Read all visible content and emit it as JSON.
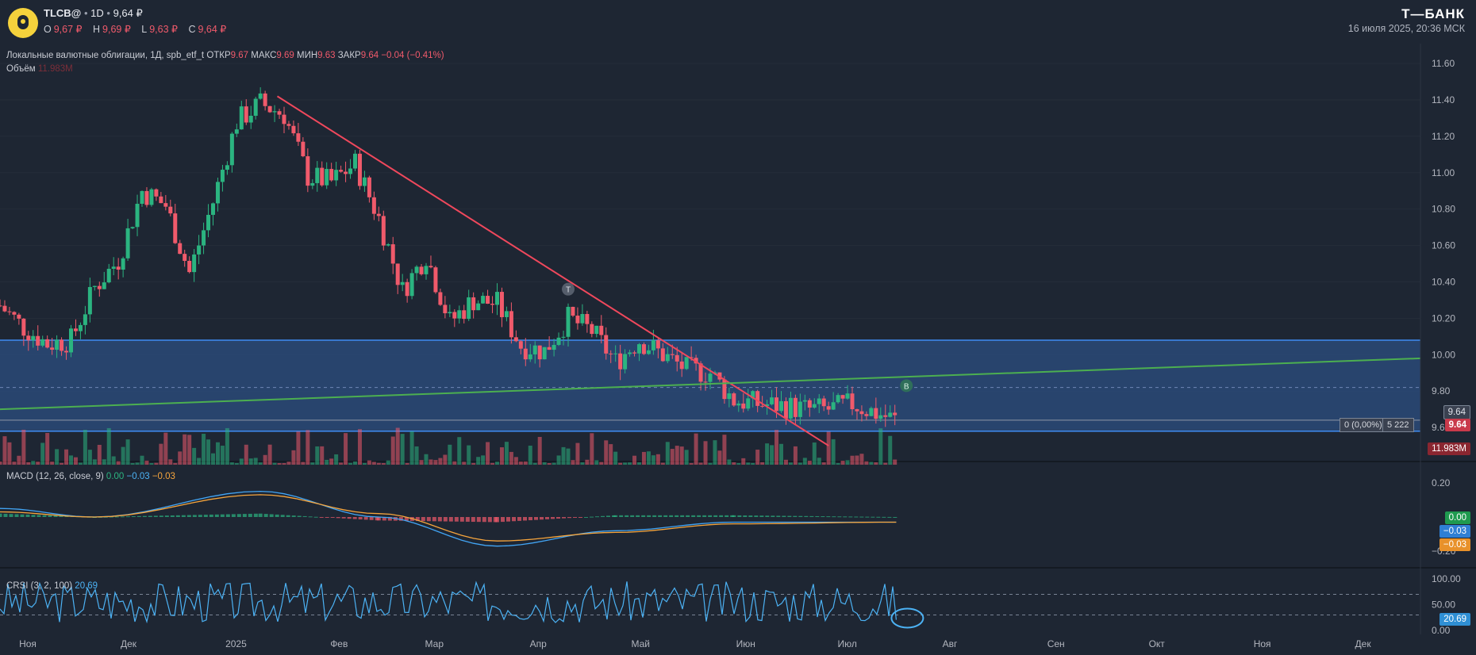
{
  "header": {
    "ticker": "TLCB@",
    "interval": "1D",
    "price": "9,64 ₽",
    "ohlc": [
      {
        "k": "O",
        "v": "9,67 ₽"
      },
      {
        "k": "H",
        "v": "9,69 ₽"
      },
      {
        "k": "L",
        "v": "9,63 ₽"
      },
      {
        "k": "C",
        "v": "9,64 ₽"
      }
    ],
    "brand": "Т—БАНК",
    "datetime": "16 июля 2025, 20:36 МСК"
  },
  "legend": {
    "name": "Локальные валютные облигации, 1Д, spb_etf_t",
    "open_k": "ОТКР",
    "open_v": "9.67",
    "high_k": "МАКС",
    "high_v": "9.69",
    "low_k": "МИН",
    "low_v": "9.63",
    "close_k": "ЗАКР",
    "close_v": "9.64",
    "change": "−0.04 (−0.41%)",
    "volume_k": "Объём",
    "volume_v": "11.983M"
  },
  "macd_legend": {
    "label": "MACD (12, 26, close, 9)",
    "hist": "0.00",
    "macd": "−0.03",
    "signal": "−0.03"
  },
  "crsi_legend": {
    "label": "CRSI (3, 2, 100)",
    "value": "20.69"
  },
  "price_axis": {
    "ticks": [
      "11.60",
      "11.40",
      "11.20",
      "11.00",
      "10.80",
      "10.60",
      "10.40",
      "10.20",
      "10.00",
      "9.80",
      "9.60"
    ]
  },
  "macd_axis": {
    "ticks": [
      "0.20",
      "−0.20"
    ]
  },
  "crsi_axis": {
    "ticks": [
      "100.00",
      "50.00",
      "0.00"
    ]
  },
  "axis_tags": {
    "last_price": "9.64",
    "close_price": "9.64",
    "volume": "11.983M",
    "macd_hist": "0.00",
    "macd": "−0.03",
    "macd_signal": "−0.03",
    "crsi": "20.69"
  },
  "measure_badge": {
    "change": "0 (0,00%)",
    "bars": "5 222"
  },
  "markers": {
    "t": "T",
    "b": "B"
  },
  "time_axis": [
    "Ноя",
    "Дек",
    "2025",
    "Фев",
    "Мар",
    "Апр",
    "Май",
    "Июн",
    "Июл",
    "Авг",
    "Сен",
    "Окт",
    "Ноя",
    "Дек"
  ],
  "colors": {
    "bg": "#1e2633",
    "up": "#2bb480",
    "down": "#f05a6b",
    "zone": "#2a4a78",
    "zone_line": "#3f8cf3",
    "trend_down": "#f0485c",
    "trend_up": "#4caf50",
    "macd": "#42a5f5",
    "signal": "#f6a53d",
    "crsi": "#4cb2f4"
  },
  "chart_data": [
    {
      "type": "candlestick",
      "title": "Локальные валютные облигации, 1Д, spb_etf_t",
      "ylim": [
        9.57,
        11.67
      ],
      "x_range": [
        "2024-10-24",
        "2025-12-18"
      ],
      "price_close_series": [
        [
          "2024-10-24",
          10.27
        ],
        [
          "2024-10-31",
          10.15
        ],
        [
          "2024-11-07",
          10.06
        ],
        [
          "2024-11-14",
          10.08
        ],
        [
          "2024-11-21",
          10.37
        ],
        [
          "2024-11-28",
          10.52
        ],
        [
          "2024-12-05",
          10.9
        ],
        [
          "2024-12-12",
          10.82
        ],
        [
          "2024-12-19",
          10.45
        ],
        [
          "2024-12-26",
          10.84
        ],
        [
          "2025-01-02",
          11.28
        ],
        [
          "2025-01-09",
          11.38
        ],
        [
          "2025-01-16",
          11.32
        ],
        [
          "2025-01-23",
          10.98
        ],
        [
          "2025-01-30",
          10.95
        ],
        [
          "2025-02-06",
          11.05
        ],
        [
          "2025-02-13",
          10.75
        ],
        [
          "2025-02-20",
          10.35
        ],
        [
          "2025-02-27",
          10.55
        ],
        [
          "2025-03-06",
          10.18
        ],
        [
          "2025-03-13",
          10.3
        ],
        [
          "2025-03-20",
          10.28
        ],
        [
          "2025-03-27",
          10.05
        ],
        [
          "2025-04-03",
          10.02
        ],
        [
          "2025-04-10",
          10.2
        ],
        [
          "2025-04-17",
          10.13
        ],
        [
          "2025-04-24",
          9.96
        ],
        [
          "2025-05-01",
          10.08
        ],
        [
          "2025-05-08",
          10.0
        ],
        [
          "2025-05-15",
          9.92
        ],
        [
          "2025-05-22",
          9.9
        ],
        [
          "2025-05-29",
          9.75
        ],
        [
          "2025-06-05",
          9.73
        ],
        [
          "2025-06-12",
          9.72
        ],
        [
          "2025-06-19",
          9.7
        ],
        [
          "2025-06-26",
          9.7
        ],
        [
          "2025-07-03",
          9.73
        ],
        [
          "2025-07-10",
          9.68
        ],
        [
          "2025-07-16",
          9.64
        ]
      ],
      "volume_last": "11.983M",
      "resistance_zone": [
        9.58,
        10.08
      ],
      "dashed_level": 9.82,
      "current_level": 9.64,
      "down_trendline": [
        [
          "2025-01-14",
          11.42
        ],
        [
          "2025-06-26",
          9.5
        ]
      ],
      "up_trendline": [
        [
          "2024-10-24",
          9.7
        ],
        [
          "2025-12-18",
          9.98
        ]
      ]
    },
    {
      "type": "line",
      "title": "MACD (12, 26, close, 9)",
      "ylim": [
        -0.25,
        0.25
      ],
      "series": [
        {
          "name": "MACD",
          "x": [
            "2024-10-24",
            "2024-11-21",
            "2025-01-09",
            "2025-02-13",
            "2025-03-20",
            "2025-04-24",
            "2025-05-29",
            "2025-07-16"
          ],
          "values": [
            0.05,
            0.0,
            0.15,
            0.0,
            -0.17,
            -0.08,
            -0.03,
            -0.03
          ]
        },
        {
          "name": "Signal",
          "x": [
            "2024-10-24",
            "2024-11-21",
            "2025-01-09",
            "2025-02-13",
            "2025-03-20",
            "2025-04-24",
            "2025-05-29",
            "2025-07-16"
          ],
          "values": [
            0.03,
            0.0,
            0.13,
            0.02,
            -0.14,
            -0.09,
            -0.04,
            -0.03
          ]
        }
      ]
    },
    {
      "type": "line",
      "title": "CRSI (3, 2, 100)",
      "ylim": [
        0,
        100
      ],
      "series": [
        {
          "name": "CRSI",
          "x": [
            "2024-10-24",
            "2025-07-16"
          ],
          "values": [
            55,
            20.69
          ]
        }
      ]
    }
  ]
}
